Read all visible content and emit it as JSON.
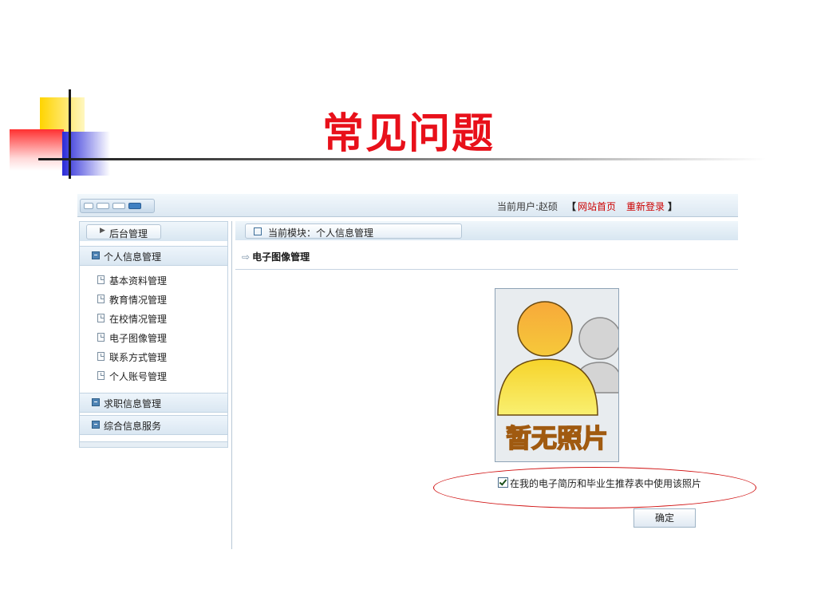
{
  "slide": {
    "title": "常见问题"
  },
  "topbar": {
    "current_user": "当前用户:赵硕",
    "bracket_open": "【",
    "bracket_close": "】",
    "home_link": "网站首页",
    "relogin_link": "重新登录"
  },
  "sidebar": {
    "header_label": "后台管理",
    "groups": [
      {
        "label": "个人信息管理",
        "items": [
          {
            "label": "基本资料管理"
          },
          {
            "label": "教育情况管理"
          },
          {
            "label": "在校情况管理"
          },
          {
            "label": "电子图像管理"
          },
          {
            "label": "联系方式管理"
          },
          {
            "label": "个人账号管理"
          }
        ]
      },
      {
        "label": "求职信息管理"
      },
      {
        "label": "综合信息服务"
      }
    ]
  },
  "main": {
    "breadcrumb": "当前模块：个人信息管理",
    "section_title": "电子图像管理",
    "photo_placeholder_text": "暂无照片",
    "use_photo_option": {
      "label": "在我的电子简历和毕业生推荐表中使用该照片",
      "checked": true
    },
    "confirm_button": "确定"
  },
  "colors": {
    "title_red": "#e8101a",
    "link_red": "#cc0000",
    "highlight_ellipse": "#d01010",
    "photo_text_orange": "#f0a21a"
  }
}
